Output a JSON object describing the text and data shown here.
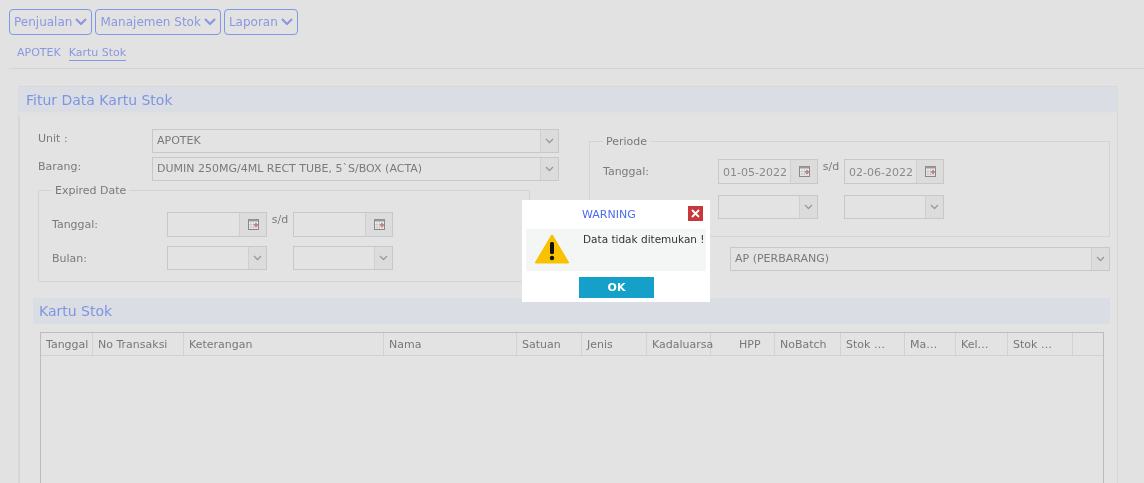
{
  "menu": [
    {
      "label": "Penjualan"
    },
    {
      "label": "Manajemen Stok"
    },
    {
      "label": "Laporan"
    }
  ],
  "breadcrumb": [
    {
      "label": "APOTEK",
      "selected": false
    },
    {
      "label": "Kartu Stok",
      "selected": true
    }
  ],
  "form_panel": {
    "title": "Fitur Data Kartu Stok",
    "unit": {
      "label": "Unit :",
      "value": "APOTEK"
    },
    "barang": {
      "label": "Barang:",
      "value": "DUMIN 250MG/4ML RECT TUBE, 5`S/BOX (ACTA)"
    },
    "expired_date": {
      "legend": "Expired Date",
      "tanggal_label": "Tanggal:",
      "separator": "s/d",
      "bulan_label": "Bulan:"
    },
    "periode": {
      "legend": "Periode",
      "tanggal_label": "Tanggal:",
      "date_from": "01-05-2022",
      "separator": "s/d",
      "date_to": "02-06-2022"
    },
    "report_type": {
      "value": "AP (PERBARANG)"
    }
  },
  "table_panel": {
    "title": "Kartu Stok",
    "columns": [
      "Tanggal",
      "No Transaksi",
      "Keterangan",
      "Nama",
      "Satuan",
      "Jenis",
      "Kadaluarsa",
      "HPP",
      "NoBatch",
      "Stok …",
      "Ma…",
      "Kel…",
      "Stok …"
    ]
  },
  "dialog": {
    "title": "WARNING",
    "message": "Data tidak ditemukan !",
    "button": "OK"
  }
}
